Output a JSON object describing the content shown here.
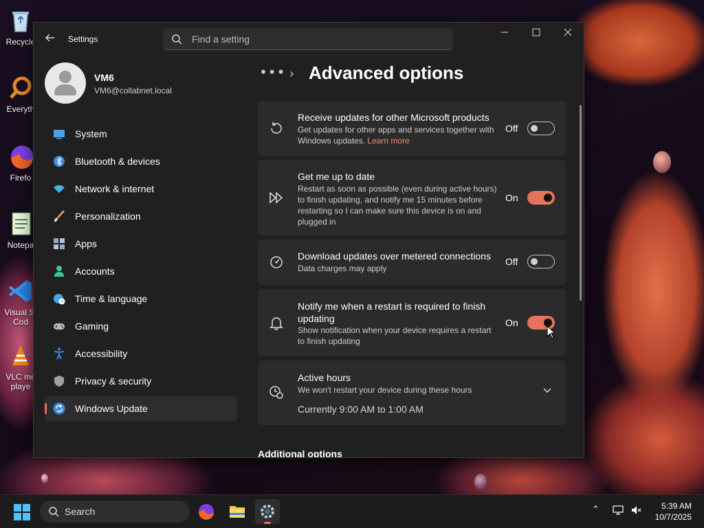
{
  "desktop": {
    "icons": [
      {
        "name": "recycle-bin",
        "label": "Recycle",
        "color": "#8ab4d8"
      },
      {
        "name": "everything",
        "label": "Everyth",
        "color": "#e98a2a"
      },
      {
        "name": "firefox",
        "label": "Firefo",
        "color": "#e8632b"
      },
      {
        "name": "notepad",
        "label": "Notepa",
        "color": "#6fbf5b"
      },
      {
        "name": "visual-studio-code",
        "label": "Visual St",
        "label2": "Cod",
        "color": "#2b7de0"
      },
      {
        "name": "vlc",
        "label": "VLC me",
        "label2": "playe",
        "color": "#f08a1c"
      }
    ]
  },
  "window": {
    "app_title": "Settings",
    "search_placeholder": "Find a setting",
    "controls": {
      "minimize": "—",
      "maximize": "☐",
      "close": "✕"
    }
  },
  "profile": {
    "name": "VM6",
    "email": "VM6@collabnet.local"
  },
  "sidebar": {
    "items": [
      {
        "label": "System",
        "icon": "system-icon",
        "color": "#4aa3e8"
      },
      {
        "label": "Bluetooth & devices",
        "icon": "bluetooth-icon",
        "color": "#3c8be0"
      },
      {
        "label": "Network & internet",
        "icon": "wifi-icon",
        "color": "#4ab0f0"
      },
      {
        "label": "Personalization",
        "icon": "brush-icon",
        "color": "#e8a45a"
      },
      {
        "label": "Apps",
        "icon": "apps-icon",
        "color": "#9aa7c4"
      },
      {
        "label": "Accounts",
        "icon": "accounts-icon",
        "color": "#3fc3a3"
      },
      {
        "label": "Time & language",
        "icon": "globe-clock-icon",
        "color": "#4aa3e8"
      },
      {
        "label": "Gaming",
        "icon": "gamepad-icon",
        "color": "#b8b8b8"
      },
      {
        "label": "Accessibility",
        "icon": "accessibility-icon",
        "color": "#3c8be0"
      },
      {
        "label": "Privacy & security",
        "icon": "shield-icon",
        "color": "#a0a0a0"
      },
      {
        "label": "Windows Update",
        "icon": "update-icon",
        "color": "#3c8be0",
        "active": true
      }
    ]
  },
  "breadcrumb": {
    "dots": "•••",
    "separator": "›",
    "title": "Advanced options"
  },
  "settings": [
    {
      "title": "Receive updates for other Microsoft products",
      "desc": "Get updates for other apps and services together with Windows updates.",
      "link": "Learn more",
      "state": "Off",
      "icon": "history-icon"
    },
    {
      "title": "Get me up to date",
      "desc": "Restart as soon as possible (even during active hours) to finish updating, and notify me 15 minutes before restarting so I can make sure this device is on and plugged in",
      "state": "On",
      "icon": "fast-forward-icon"
    },
    {
      "title": "Download updates over metered connections",
      "desc": "Data charges may apply",
      "state": "Off",
      "icon": "speedometer-icon"
    },
    {
      "title": "Notify me when a restart is required to finish updating",
      "desc": "Show notification when your device requires a restart to finish updating",
      "state": "On",
      "icon": "bell-icon"
    },
    {
      "title": "Active hours",
      "desc": "We won't restart your device during these hours",
      "current": "Currently 9:00 AM to 1:00 AM",
      "icon": "active-hours-icon",
      "expand": "⌄"
    }
  ],
  "section_header": "Additional options",
  "taskbar": {
    "search_label": "Search",
    "apps": [
      "firefox",
      "file-explorer",
      "settings"
    ],
    "clock": {
      "time": "5:39 AM",
      "date": "10/7/2025"
    },
    "tray_chevron": "⌃"
  },
  "colors": {
    "accent": "#e6735b",
    "window_bg": "#202020",
    "card_bg": "#2b2b2b",
    "link": "#f08f6f"
  }
}
